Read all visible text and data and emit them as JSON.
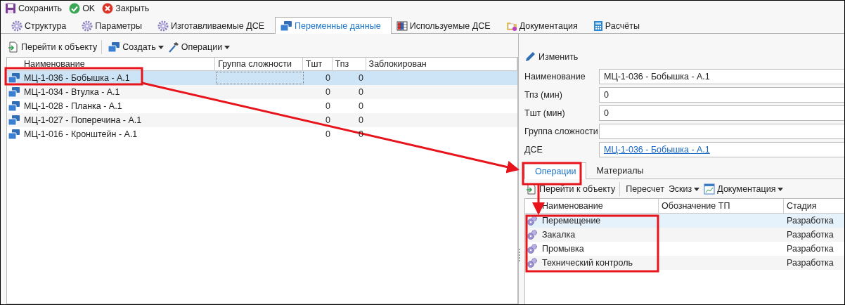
{
  "toolbar": [
    {
      "label": "Сохранить",
      "kind": "save"
    },
    {
      "label": "OK",
      "kind": "ok"
    },
    {
      "label": "Закрыть",
      "kind": "close"
    }
  ],
  "tabs": [
    {
      "label": "Структура",
      "kind": "gear",
      "selected": false
    },
    {
      "label": "Параметры",
      "kind": "gear",
      "selected": false
    },
    {
      "label": "Изготавливаемые ДСЕ",
      "kind": "gear",
      "selected": false
    },
    {
      "label": "Переменные данные",
      "kind": "layers",
      "selected": true
    },
    {
      "label": "Используемые ДСЕ",
      "kind": "grid",
      "selected": false
    },
    {
      "label": "Документация",
      "kind": "folder",
      "selected": false
    },
    {
      "label": "Расчёты",
      "kind": "calc",
      "selected": false
    }
  ],
  "list_panel": {
    "toolbar": [
      {
        "label": "Перейти к объекту",
        "kind": "goto",
        "dropdown": false,
        "divider_after": true
      },
      {
        "label": "Создать",
        "kind": "layers",
        "dropdown": true,
        "divider_after": false
      },
      {
        "label": "Операции",
        "kind": "hammer",
        "dropdown": true,
        "divider_after": false
      }
    ],
    "columns": [
      "Наименование",
      "Группа сложности",
      "Тшт",
      "Тпз",
      "Заблокирован"
    ],
    "rows": [
      {
        "name": "МЦ-1-036 - Бобышка - А.1",
        "tsht": "0",
        "tpz": "0",
        "selected": true
      },
      {
        "name": "МЦ-1-034 - Втулка - А.1",
        "tsht": "0",
        "tpz": "0",
        "selected": false
      },
      {
        "name": "МЦ-1-028 - Планка - А.1",
        "tsht": "0",
        "tpz": "0",
        "selected": false
      },
      {
        "name": "МЦ-1-027 - Поперечина - А.1",
        "tsht": "0",
        "tpz": "0",
        "selected": false
      },
      {
        "name": "МЦ-1-016 - Кронштейн - А.1",
        "tsht": "0",
        "tpz": "0",
        "selected": false
      }
    ]
  },
  "details": {
    "action": "Изменить",
    "fields": [
      {
        "label": "Наименование",
        "value": "МЦ-1-036 - Бобышка - А.1",
        "kind": "text"
      },
      {
        "label": "Тпз (мин)",
        "value": "0",
        "kind": "text"
      },
      {
        "label": "Тшт (мин)",
        "value": "0",
        "kind": "text"
      },
      {
        "label": "Группа сложности",
        "kind": "text"
      },
      {
        "label": "ДСЕ",
        "value": "МЦ-1-036 - Бобышка - А.1",
        "kind": "link"
      }
    ],
    "tabs": [
      {
        "label": "Операции",
        "selected": true
      },
      {
        "label": "Материалы",
        "selected": false
      }
    ],
    "toolbar": [
      {
        "label": "Перейти к объекту",
        "kind": "goto",
        "dropdown": false,
        "divider_after": true
      },
      {
        "label": "Пересчет",
        "kind": "plain",
        "dropdown": false,
        "divider_after": false
      },
      {
        "label": "Эскиз",
        "kind": "plain",
        "dropdown": true,
        "divider_after": false
      },
      {
        "label": "Документация",
        "kind": "chart",
        "dropdown": true,
        "divider_after": false
      }
    ],
    "columns": [
      "Наименование",
      "Обозначение ТП",
      "Стадия"
    ],
    "rows": [
      {
        "name": "Перемещение",
        "stage": "Разработка",
        "selected": true
      },
      {
        "name": "Закалка",
        "stage": "Разработка",
        "selected": false
      },
      {
        "name": "Промывка",
        "stage": "Разработка",
        "selected": false
      },
      {
        "name": "Технический контроль",
        "stage": "Разработка",
        "selected": false
      }
    ]
  }
}
